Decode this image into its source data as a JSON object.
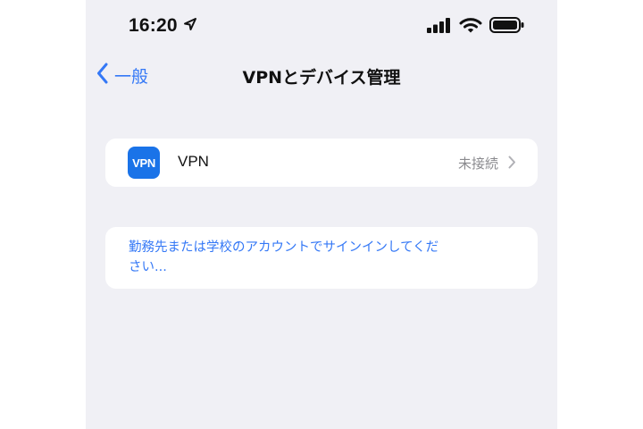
{
  "status_bar": {
    "time": "16:20",
    "location_icon": "location-arrow-icon",
    "signal_icon": "cellular-signal-icon",
    "wifi_icon": "wifi-icon",
    "battery_icon": "battery-icon"
  },
  "nav": {
    "back_label": "一般",
    "title": "VPNとデバイス管理"
  },
  "vpn_row": {
    "icon_text": "VPN",
    "label": "VPN",
    "status": "未接続"
  },
  "signin_row": {
    "text": "勤務先または学校のアカウントでサインインしてください..."
  },
  "colors": {
    "accent": "#3478f6",
    "background": "#f0f0f5",
    "card": "#ffffff",
    "vpn_icon_bg": "#1a73e8",
    "secondary_text": "#8a8a8e"
  }
}
